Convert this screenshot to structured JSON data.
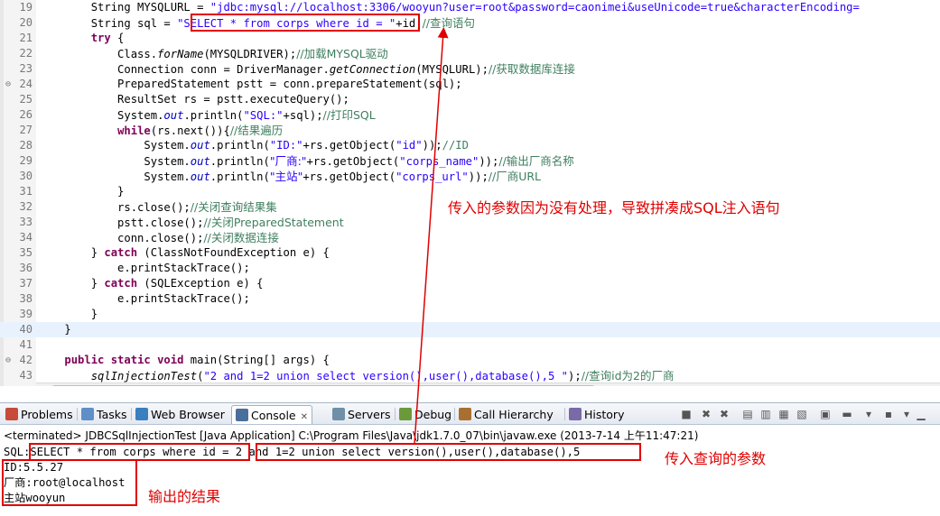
{
  "editor": {
    "lines": [
      {
        "num": "19",
        "segs": [
          {
            "t": "        String MYSQLURL = ",
            "c": ""
          },
          {
            "t": "\"jdbc:mysql://localhost:3306/wooyun?user=root&password=caonimei&useUnicode=true&characterEncoding=",
            "c": "str"
          }
        ]
      },
      {
        "num": "20",
        "segs": [
          {
            "t": "        String sql = ",
            "c": ""
          },
          {
            "t": "\"SELECT * from corps where id = \"",
            "c": "str"
          },
          {
            "t": "+id;",
            "c": ""
          },
          {
            "t": "//查询语句",
            "c": "cmt"
          }
        ]
      },
      {
        "num": "21",
        "segs": [
          {
            "t": "        ",
            "c": ""
          },
          {
            "t": "try",
            "c": "kw"
          },
          {
            "t": " {",
            "c": ""
          }
        ]
      },
      {
        "num": "22",
        "segs": [
          {
            "t": "            Class.",
            "c": ""
          },
          {
            "t": "forName",
            "c": "ital"
          },
          {
            "t": "(MYSQLDRIVER);",
            "c": ""
          },
          {
            "t": "//加载MYSQL驱动",
            "c": "cmt"
          }
        ]
      },
      {
        "num": "23",
        "segs": [
          {
            "t": "            Connection conn = DriverManager.",
            "c": ""
          },
          {
            "t": "getConnection",
            "c": "ital"
          },
          {
            "t": "(MYSQLURL);",
            "c": ""
          },
          {
            "t": "//获取数据库连接",
            "c": "cmt"
          }
        ]
      },
      {
        "num": "24",
        "mark": "⊖",
        "segs": [
          {
            "t": "            PreparedStatement pstt = conn.prepareStatement(sql);",
            "c": ""
          }
        ]
      },
      {
        "num": "25",
        "segs": [
          {
            "t": "            ResultSet rs = pstt.executeQuery();",
            "c": ""
          }
        ]
      },
      {
        "num": "26",
        "segs": [
          {
            "t": "            System.",
            "c": ""
          },
          {
            "t": "out",
            "c": "field"
          },
          {
            "t": ".println(",
            "c": ""
          },
          {
            "t": "\"SQL:\"",
            "c": "str"
          },
          {
            "t": "+sql);",
            "c": ""
          },
          {
            "t": "//打印SQL",
            "c": "cmt"
          }
        ]
      },
      {
        "num": "27",
        "segs": [
          {
            "t": "            ",
            "c": ""
          },
          {
            "t": "while",
            "c": "kw"
          },
          {
            "t": "(rs.next()){",
            "c": ""
          },
          {
            "t": "//结果遍历",
            "c": "cmt"
          }
        ]
      },
      {
        "num": "28",
        "segs": [
          {
            "t": "                System.",
            "c": ""
          },
          {
            "t": "out",
            "c": "field"
          },
          {
            "t": ".println(",
            "c": ""
          },
          {
            "t": "\"ID:\"",
            "c": "str"
          },
          {
            "t": "+rs.getObject(",
            "c": ""
          },
          {
            "t": "\"id\"",
            "c": "str"
          },
          {
            "t": "));",
            "c": ""
          },
          {
            "t": "//ID",
            "c": "cmt"
          }
        ]
      },
      {
        "num": "29",
        "segs": [
          {
            "t": "                System.",
            "c": ""
          },
          {
            "t": "out",
            "c": "field"
          },
          {
            "t": ".println(",
            "c": ""
          },
          {
            "t": "\"厂商:\"",
            "c": "str"
          },
          {
            "t": "+rs.getObject(",
            "c": ""
          },
          {
            "t": "\"corps_name\"",
            "c": "str"
          },
          {
            "t": "));",
            "c": ""
          },
          {
            "t": "//输出厂商名称",
            "c": "cmt"
          }
        ]
      },
      {
        "num": "30",
        "segs": [
          {
            "t": "                System.",
            "c": ""
          },
          {
            "t": "out",
            "c": "field"
          },
          {
            "t": ".println(",
            "c": ""
          },
          {
            "t": "\"主站\"",
            "c": "str"
          },
          {
            "t": "+rs.getObject(",
            "c": ""
          },
          {
            "t": "\"corps_url\"",
            "c": "str"
          },
          {
            "t": "));",
            "c": ""
          },
          {
            "t": "//厂商URL",
            "c": "cmt"
          }
        ]
      },
      {
        "num": "31",
        "segs": [
          {
            "t": "            }",
            "c": ""
          }
        ]
      },
      {
        "num": "32",
        "segs": [
          {
            "t": "            rs.close();",
            "c": ""
          },
          {
            "t": "//关闭查询结果集",
            "c": "cmt"
          }
        ]
      },
      {
        "num": "33",
        "segs": [
          {
            "t": "            pstt.close();",
            "c": ""
          },
          {
            "t": "//关闭PreparedStatement",
            "c": "cmt"
          }
        ]
      },
      {
        "num": "34",
        "segs": [
          {
            "t": "            conn.close();",
            "c": ""
          },
          {
            "t": "//关闭数据连接",
            "c": "cmt"
          }
        ]
      },
      {
        "num": "35",
        "segs": [
          {
            "t": "        } ",
            "c": ""
          },
          {
            "t": "catch",
            "c": "kw"
          },
          {
            "t": " (ClassNotFoundException e) {",
            "c": ""
          }
        ]
      },
      {
        "num": "36",
        "segs": [
          {
            "t": "            e.printStackTrace();",
            "c": ""
          }
        ]
      },
      {
        "num": "37",
        "segs": [
          {
            "t": "        } ",
            "c": ""
          },
          {
            "t": "catch",
            "c": "kw"
          },
          {
            "t": " (SQLException e) {",
            "c": ""
          }
        ]
      },
      {
        "num": "38",
        "segs": [
          {
            "t": "            e.printStackTrace();",
            "c": ""
          }
        ]
      },
      {
        "num": "39",
        "segs": [
          {
            "t": "        }",
            "c": ""
          }
        ]
      },
      {
        "num": "40",
        "current": true,
        "segs": [
          {
            "t": "    }",
            "c": ""
          }
        ]
      },
      {
        "num": "41",
        "segs": [
          {
            "t": "",
            "c": ""
          }
        ]
      },
      {
        "num": "42",
        "mark": "⊖",
        "segs": [
          {
            "t": "    ",
            "c": ""
          },
          {
            "t": "public static void",
            "c": "kw"
          },
          {
            "t": " main(String[] args) {",
            "c": ""
          }
        ]
      },
      {
        "num": "43",
        "segs": [
          {
            "t": "        ",
            "c": ""
          },
          {
            "t": "sqlInjectionTest",
            "c": "ital"
          },
          {
            "t": "(",
            "c": ""
          },
          {
            "t": "\"2 and 1=2 union select version(),user(),database(),5 \"",
            "c": "str"
          },
          {
            "t": ");",
            "c": ""
          },
          {
            "t": "//查询id为2的厂商",
            "c": "cmt"
          }
        ]
      }
    ]
  },
  "console": {
    "tabs": [
      {
        "label": "Problems",
        "icon": "problems-icon",
        "color": "#c84a3a"
      },
      {
        "label": "Tasks",
        "icon": "tasks-icon",
        "color": "#5f8fc7"
      },
      {
        "label": "Web Browser",
        "icon": "globe-icon",
        "color": "#3a7fc0"
      },
      {
        "label": "Console",
        "icon": "console-icon",
        "color": "#4a6f9a",
        "active": true,
        "close": "✕"
      },
      {
        "label": "Servers",
        "icon": "servers-icon",
        "color": "#6f8fa8"
      },
      {
        "label": "Debug",
        "icon": "debug-icon",
        "color": "#6a9a3a"
      },
      {
        "label": "Call Hierarchy",
        "icon": "call-hierarchy-icon",
        "color": "#a87030"
      },
      {
        "label": "History",
        "icon": "history-icon",
        "color": "#7a6aa8"
      }
    ],
    "terminated": "<terminated> JDBCSqlInjectionTest [Java Application] C:\\Program Files\\Java\\jdk1.7.0_07\\bin\\javaw.exe (2013-7-14 上午11:47:21)",
    "output": [
      "SQL:SELECT * from corps where id = 2 and 1=2 union select version(),user(),database(),5",
      "ID:5.5.27",
      "厂商:root@localhost",
      "主站wooyun"
    ]
  },
  "annotations": {
    "injection_note": "传入的参数因为没有处理，导致拼凑成SQL注入语句",
    "param_note": "传入查询的参数",
    "result_note": "输出的结果",
    "color": "#e00000"
  }
}
